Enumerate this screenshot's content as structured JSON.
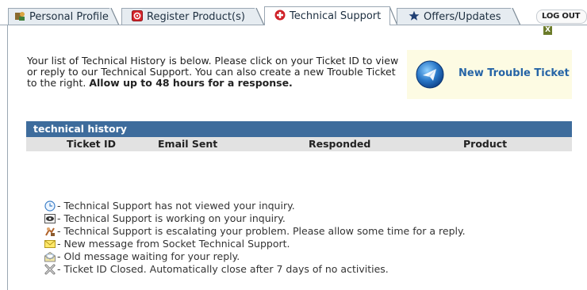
{
  "tabs": [
    {
      "label": "Personal Profile",
      "icon": "profile-icon",
      "active": false
    },
    {
      "label": "Register Product(s)",
      "icon": "register-icon",
      "active": false
    },
    {
      "label": "Technical Support",
      "icon": "support-icon",
      "active": true
    },
    {
      "label": "Offers/Updates",
      "icon": "star-icon",
      "active": false
    }
  ],
  "logout_label": "LOG OUT",
  "logout_x": "X",
  "intro": {
    "text": "Your list of Technical History is below. Please click on your Ticket ID to view or reply to our Technical Support. You can also create a new Trouble Ticket to the right.",
    "bold": "Allow up to 48 hours for a response."
  },
  "new_ticket_label": "New Trouble Ticket",
  "history": {
    "title": "technical history",
    "columns": [
      "Ticket ID",
      "Email Sent",
      "Responded",
      "Product"
    ]
  },
  "legend": [
    {
      "icon": "clock-icon",
      "text": "- Technical Support has not viewed your inquiry."
    },
    {
      "icon": "eye-icon",
      "text": "- Technical Support is working on your inquiry."
    },
    {
      "icon": "escalate-icon",
      "text": "- Technical Support is escalating your problem. Please allow some time for a reply."
    },
    {
      "icon": "new-mail-icon",
      "text": "- New message from Socket Technical Support."
    },
    {
      "icon": "open-mail-icon",
      "text": "- Old message waiting for your reply."
    },
    {
      "icon": "closed-x-icon",
      "text": "- Ticket ID Closed. Automatically close after 7 days of no activities."
    }
  ],
  "colors": {
    "header_blue": "#3e6c9c",
    "link_blue": "#2664a6",
    "tab_bg": "#e6ecf1",
    "new_ticket_bg": "#fdfbe3"
  }
}
